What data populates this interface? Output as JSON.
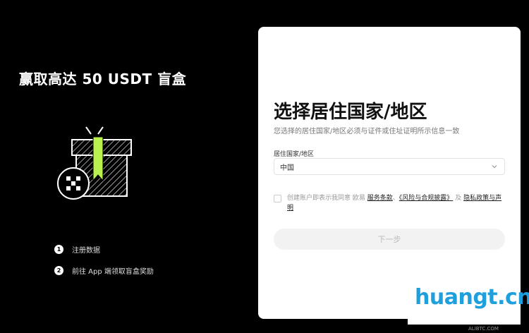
{
  "promo": {
    "title": "赢取高达 50 USDT 盲盒",
    "steps": [
      {
        "num": "1",
        "label": "注册数据"
      },
      {
        "num": "2",
        "label": "前往 App 端领取盲盒奖励"
      }
    ]
  },
  "form": {
    "title": "选择居住国家/地区",
    "subtitle": "您选择的居住国家/地区必须与证件或住址证明所示信息一致",
    "field_label": "居住国家/地区",
    "selected_value": "中国",
    "agree_prefix": "创建账户即表示我同意 欧易",
    "agree_link1": "服务条款",
    "agree_mid": "、",
    "agree_link2": "《风险与合规披露》",
    "agree_and": "及",
    "agree_link3": "隐私政策与声明",
    "next_label": "下一步"
  },
  "watermark": {
    "text": "huangt.cn",
    "badge": "ALIBTC.COM"
  },
  "colors": {
    "background": "#000000",
    "card": "#ffffff",
    "accent_green": "#b9f24f",
    "watermark_blue": "#1fa0dc"
  }
}
